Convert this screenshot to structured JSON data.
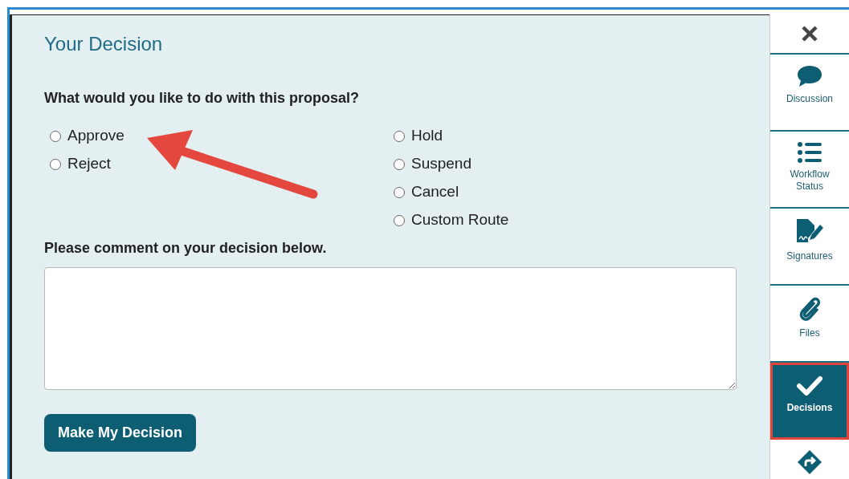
{
  "panel": {
    "title": "Your Decision",
    "question": "What would you like to do with this proposal?",
    "option_columns": [
      [
        {
          "label": "Approve",
          "selected": false
        },
        {
          "label": "Reject",
          "selected": false
        }
      ],
      [
        {
          "label": "Hold",
          "selected": false
        },
        {
          "label": "Suspend",
          "selected": false
        },
        {
          "label": "Cancel",
          "selected": false
        },
        {
          "label": "Custom Route",
          "selected": false
        }
      ]
    ],
    "comment_label": "Please comment on your decision below.",
    "submit_button": "Make My Decision"
  },
  "sidebar": {
    "items": [
      {
        "kind": "close",
        "selected": false
      },
      {
        "kind": "tab",
        "label": "Discussion",
        "selected": false
      },
      {
        "kind": "tab",
        "label": "Workflow Status",
        "selected": false
      },
      {
        "kind": "tab",
        "label": "Signatures",
        "selected": false
      },
      {
        "kind": "tab",
        "label": "Files",
        "selected": false
      },
      {
        "kind": "tab",
        "label": "Decisions",
        "selected": true
      },
      {
        "kind": "tab",
        "selected": false
      }
    ]
  }
}
